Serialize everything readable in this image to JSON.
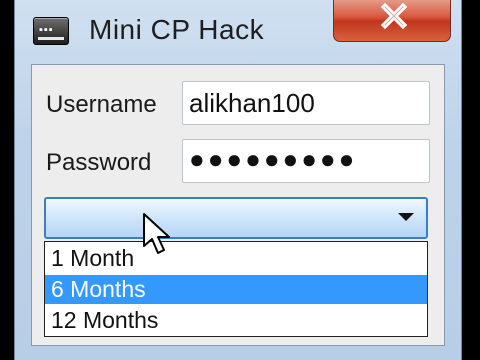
{
  "window": {
    "title": "Mini CP Hack"
  },
  "form": {
    "username_label": "Username",
    "username_value": "alikhan100",
    "password_label": "Password",
    "password_value": "●●●●●●●●●"
  },
  "plan_select": {
    "selected": "",
    "options": [
      "1 Month",
      "6 Months",
      "12 Months"
    ],
    "highlighted": "6 Months"
  },
  "colors": {
    "highlight": "#3399ff",
    "close": "#c9472d"
  }
}
